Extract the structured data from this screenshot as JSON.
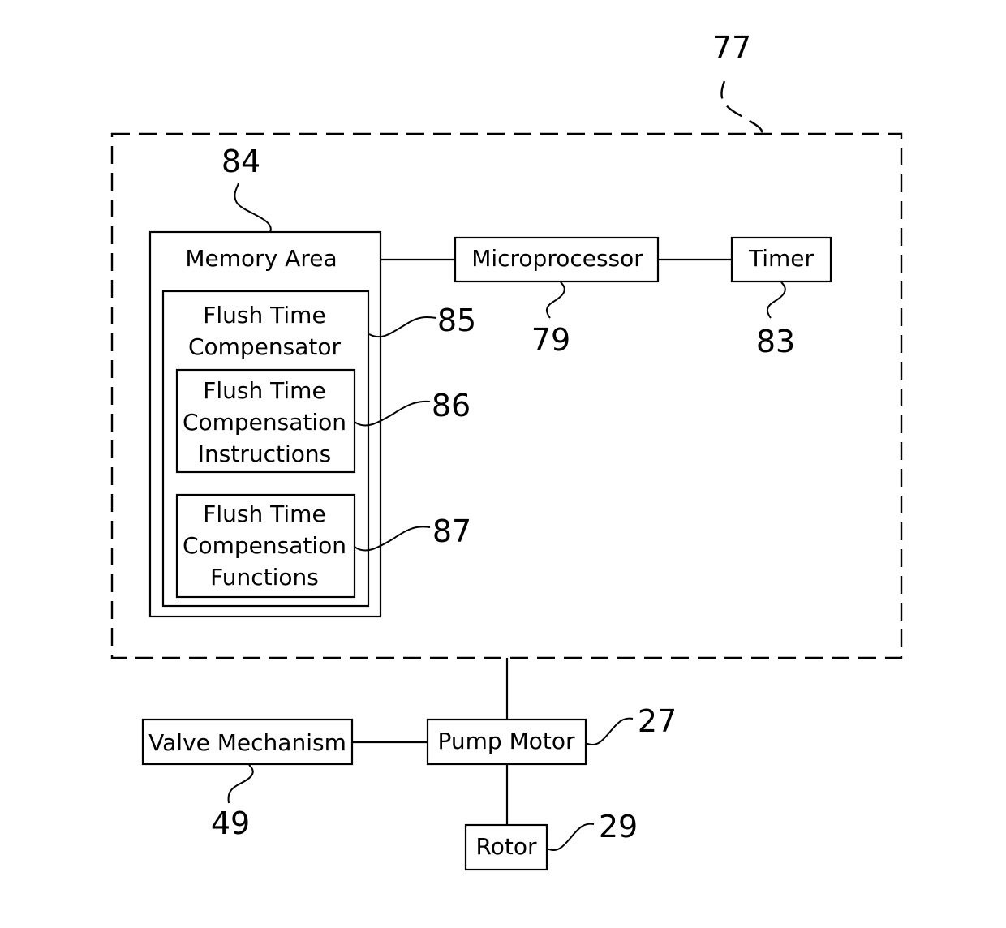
{
  "diagram": {
    "type": "block-diagram",
    "container": {
      "ref": "77",
      "style": "dashed"
    },
    "blocks": {
      "memory_area": {
        "label": "Memory Area",
        "ref": "84"
      },
      "flush_time_compensator": {
        "label_lines": [
          "Flush Time",
          "Compensator"
        ],
        "ref": "85"
      },
      "instructions": {
        "label_lines": [
          "Flush Time",
          "Compensation",
          "Instructions"
        ],
        "ref": "86"
      },
      "functions": {
        "label_lines": [
          "Flush Time",
          "Compensation",
          "Functions"
        ],
        "ref": "87"
      },
      "microprocessor": {
        "label": "Microprocessor",
        "ref": "79"
      },
      "timer": {
        "label": "Timer",
        "ref": "83"
      },
      "valve_mechanism": {
        "label": "Valve Mechanism",
        "ref": "49"
      },
      "pump_motor": {
        "label": "Pump Motor",
        "ref": "27"
      },
      "rotor": {
        "label": "Rotor",
        "ref": "29"
      }
    },
    "connections": [
      [
        "memory_area",
        "microprocessor"
      ],
      [
        "microprocessor",
        "timer"
      ],
      [
        "container",
        "pump_motor"
      ],
      [
        "valve_mechanism",
        "pump_motor"
      ],
      [
        "pump_motor",
        "rotor"
      ]
    ]
  }
}
